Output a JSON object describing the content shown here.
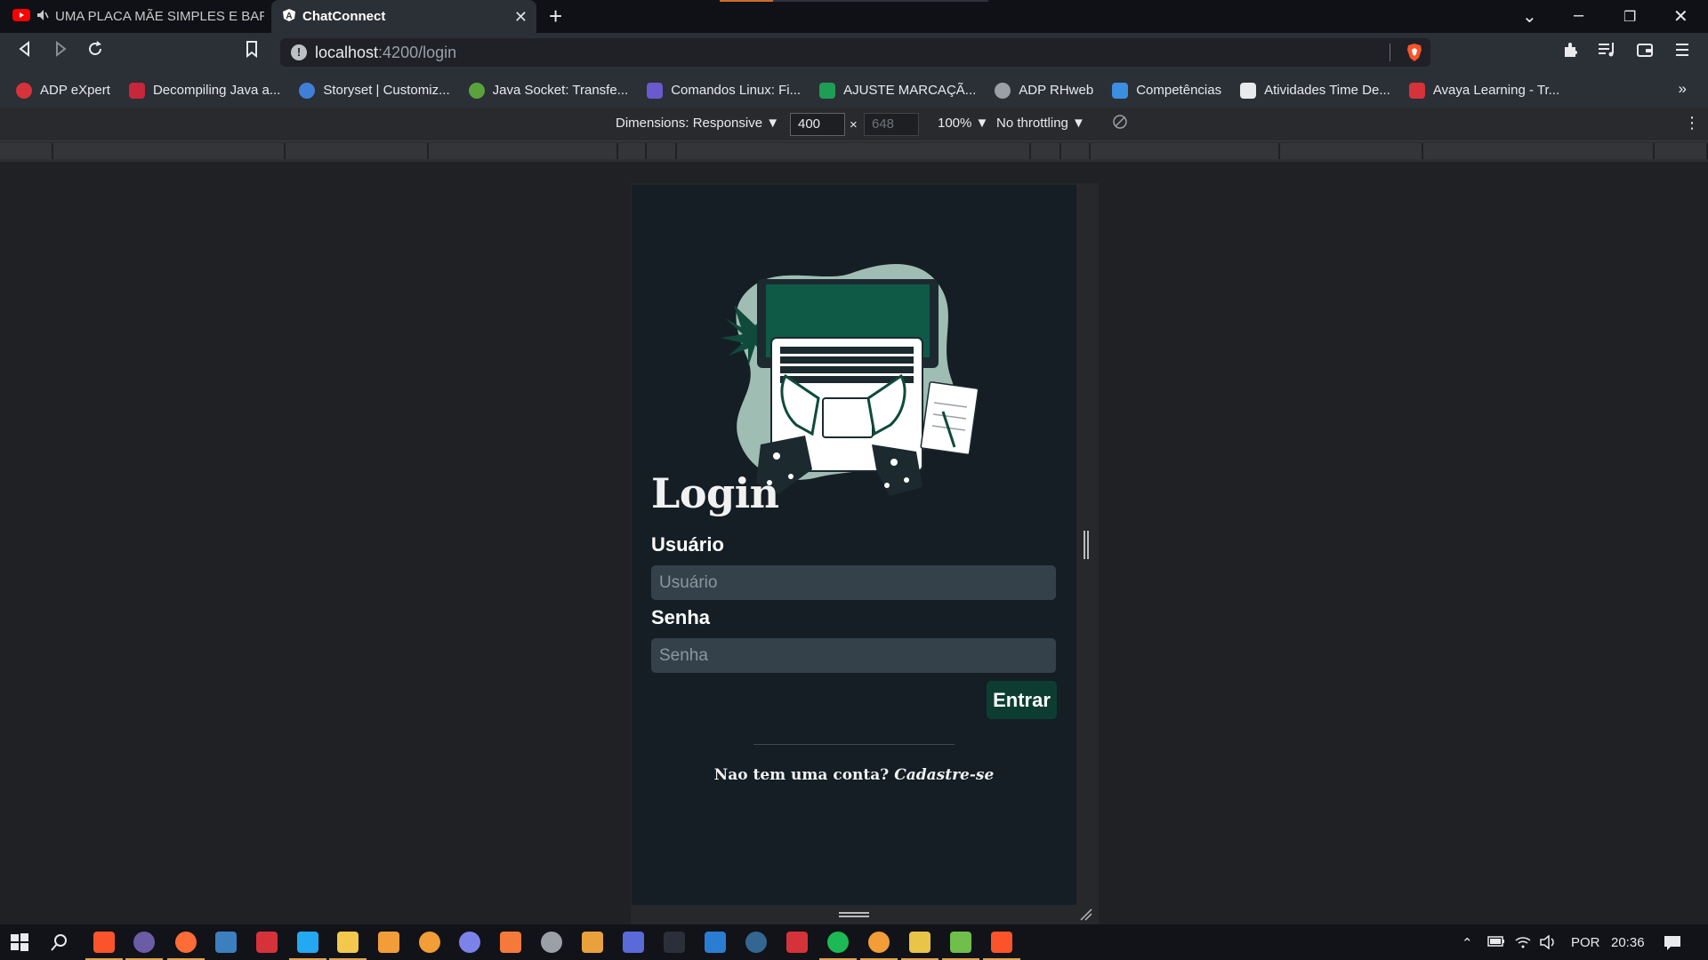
{
  "browser": {
    "tabs": [
      {
        "title": "UMA PLACA MÃE SIMPLES E BARATA",
        "favicon": "youtube-icon",
        "muted_audio": true
      },
      {
        "title": "ChatConnect",
        "favicon": "angular-icon",
        "active": true
      }
    ],
    "url": {
      "host": "localhost",
      "path": ":4200/login"
    },
    "bookmarks": [
      {
        "label": "ADP eXpert",
        "icon": "adp-icon",
        "color": "#d6323a"
      },
      {
        "label": "Decompiling Java a...",
        "icon": "decompiler-icon",
        "color": "#c8263b"
      },
      {
        "label": "Storyset | Customiz...",
        "icon": "storyset-icon",
        "color": "#3f7fd8"
      },
      {
        "label": "Java Socket: Transfe...",
        "icon": "java-icon",
        "color": "#5ba23c"
      },
      {
        "label": "Comandos Linux: Fi...",
        "icon": "linux-icon",
        "color": "#6a5acd"
      },
      {
        "label": "AJUSTE MARCAÇÃ...",
        "icon": "sheets-icon",
        "color": "#1f9d55"
      },
      {
        "label": "ADP RHweb",
        "icon": "globe-icon",
        "color": "#9aa0a6"
      },
      {
        "label": "Competências",
        "icon": "cloud-icon",
        "color": "#3b8fe0"
      },
      {
        "label": "Atividades Time De...",
        "icon": "trello-icon",
        "color": "#e8eaed"
      },
      {
        "label": "Avaya Learning - Tr...",
        "icon": "avaya-icon",
        "color": "#d6323a"
      }
    ],
    "more_bookmarks": "»"
  },
  "devtools": {
    "dimensions_label": "Dimensions: Responsive ▼",
    "width_value": "400",
    "times": "×",
    "height_value": "648",
    "zoom": "100% ▼",
    "throttling": "No throttling ▼"
  },
  "app": {
    "title": "Login",
    "username_label": "Usuário",
    "username_placeholder": "Usuário",
    "password_label": "Senha",
    "password_placeholder": "Senha",
    "submit_label": "Entrar",
    "no_account_text": "Nao tem uma conta?",
    "signup_link": "Cadastre-se",
    "colors": {
      "background": "#141e24",
      "input": "#34414a",
      "button": "#0d3d31",
      "accent_green": "#0f4a3b",
      "blob": "#9fbdb2"
    }
  },
  "taskbar": {
    "language": "POR",
    "time": "20:36"
  }
}
